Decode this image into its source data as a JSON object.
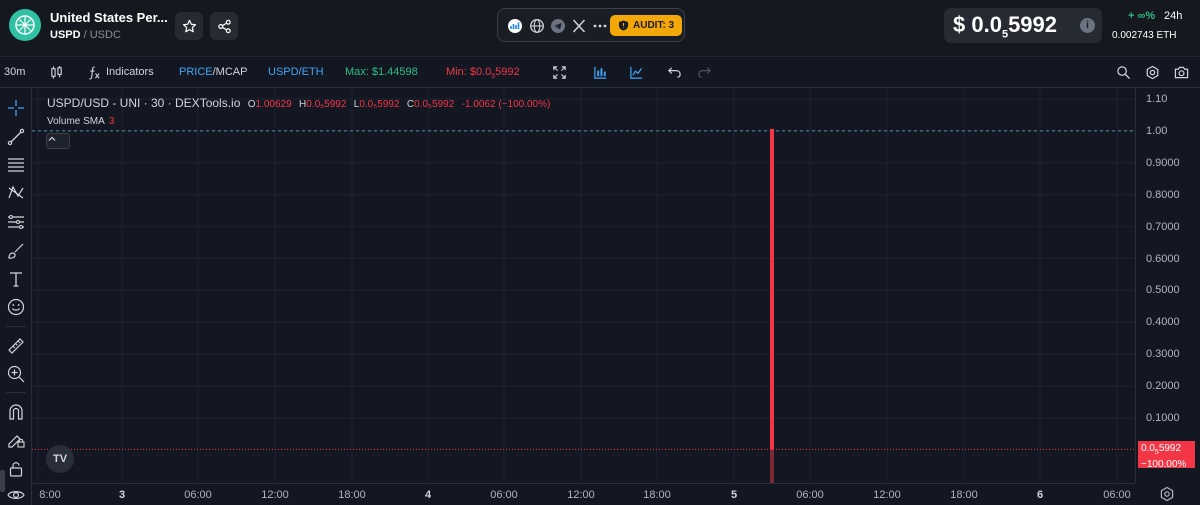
{
  "header": {
    "token_name": "United States Per...",
    "base_symbol": "USPD",
    "quote_symbol": "/ USDC",
    "audit_label": "AUDIT: 3",
    "price_prefix": "$ 0.0",
    "price_subscript": "5",
    "price_suffix": "5992",
    "price_change": "+ ∞%",
    "period": "24h",
    "eth_price": "0.002743  ETH",
    "accent_color": "#f4a708",
    "logo_color": "#2fc1a1"
  },
  "toolbar": {
    "interval": "30m",
    "indicators": "Indicators",
    "price_label": "PRICE",
    "mcap_label": "/MCAP",
    "pair_label": "USPD/ETH",
    "max_label": "Max: $1.44598",
    "min_prefix": "Min: $0.0",
    "min_sub": "5",
    "min_suffix": "5992"
  },
  "legend": {
    "title": "USPD/USD - UNI · 30 · DEXTools.io",
    "o_key": "O",
    "o_val": "1.00629",
    "h_key": "H",
    "h_val": "0.0₅5992",
    "l_key": "L",
    "l_val": "0.0₅5992",
    "c_key": "C",
    "c_val": "0.0₅5992",
    "change": "-1.0062 (−100.00%)",
    "volume_label": "Volume SMA",
    "volume_val": "3"
  },
  "price_axis": {
    "ticks": [
      "1.10",
      "1.00",
      "0.9000",
      "0.8000",
      "0.7000",
      "0.6000",
      "0.5000",
      "0.4000",
      "0.3000",
      "0.2000",
      "0.1000"
    ],
    "current_price_prefix": "0.0",
    "current_price_sub": "5",
    "current_price_suffix": "5992",
    "current_change": "−100.00%",
    "down_color": "#f23645"
  },
  "time_axis": {
    "ticks": [
      {
        "label": "8:00",
        "bold": false
      },
      {
        "label": "3",
        "bold": true
      },
      {
        "label": "06:00",
        "bold": false
      },
      {
        "label": "12:00",
        "bold": false
      },
      {
        "label": "18:00",
        "bold": false
      },
      {
        "label": "4",
        "bold": true
      },
      {
        "label": "06:00",
        "bold": false
      },
      {
        "label": "12:00",
        "bold": false
      },
      {
        "label": "18:00",
        "bold": false
      },
      {
        "label": "5",
        "bold": true
      },
      {
        "label": "06:00",
        "bold": false
      },
      {
        "label": "12:00",
        "bold": false
      },
      {
        "label": "18:00",
        "bold": false
      },
      {
        "label": "6",
        "bold": true
      },
      {
        "label": "06:00",
        "bold": false
      }
    ]
  },
  "chart_data": {
    "type": "bar",
    "categories": [
      "5 ~03:30"
    ],
    "values": [
      1.00629
    ],
    "close": 5.992e-06,
    "ylim": [
      0,
      1.1
    ],
    "last_price_line": 1.0,
    "series": [
      {
        "name": "USPD/USD - UNI · 30 · DEXTools.io",
        "values": [
          1.00629
        ]
      }
    ]
  },
  "tv_logo": "TV"
}
